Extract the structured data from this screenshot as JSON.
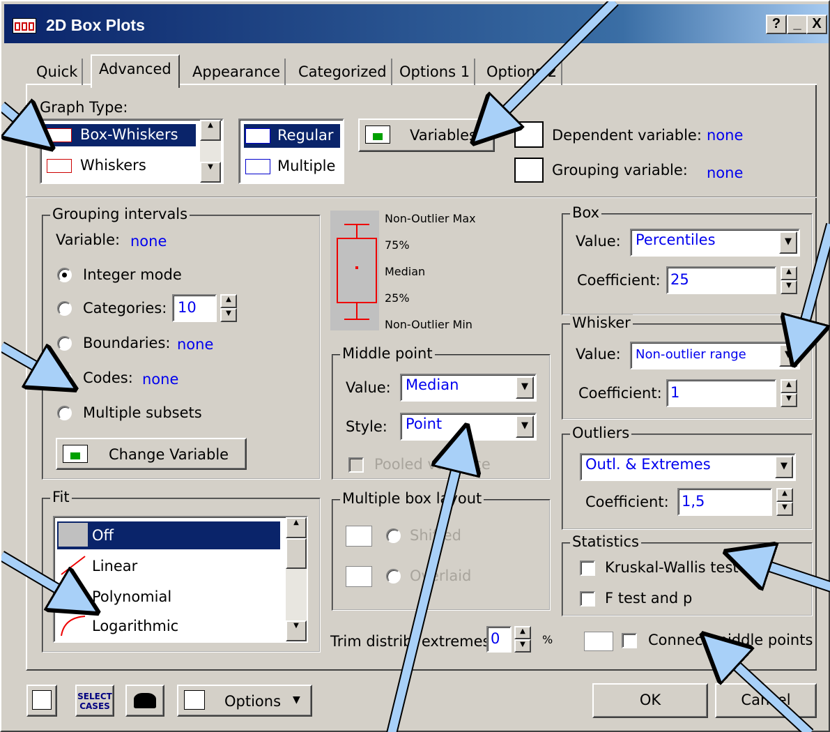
{
  "window": {
    "title": "2D Box Plots",
    "help": "?",
    "minimize": "_",
    "close": "X"
  },
  "tabs": [
    "Quick",
    "Advanced",
    "Appearance",
    "Categorized",
    "Options 1",
    "Options 2"
  ],
  "graph_type": {
    "label": "Graph Type:",
    "types": [
      "Box-Whiskers",
      "Whiskers"
    ],
    "layout": [
      "Regular",
      "Multiple"
    ],
    "variables_btn": "Variables...",
    "dependent_label": "Dependent variable:",
    "dependent_value": "none",
    "grouping_label": "Grouping variable:",
    "grouping_value": "none"
  },
  "grouping": {
    "legend": "Grouping intervals",
    "variable_label": "Variable:",
    "variable_value": "none",
    "integer_mode": "Integer mode",
    "categories": "Categories:",
    "categories_value": "10",
    "boundaries": "Boundaries:",
    "boundaries_value": "none",
    "codes": "Codes:",
    "codes_value": "none",
    "multiple_subsets": "Multiple subsets",
    "change_btn": "Change Variable"
  },
  "diagram": {
    "max": "Non-Outlier Max",
    "q75": "75%",
    "median": "Median",
    "q25": "25%",
    "min": "Non-Outlier Min"
  },
  "middle": {
    "legend": "Middle point",
    "value_label": "Value:",
    "value": "Median",
    "style_label": "Style:",
    "style": "Point",
    "pooled": "Pooled variance"
  },
  "layout": {
    "legend": "Multiple box layout",
    "shifted": "Shifted",
    "overlaid": "Overlaid"
  },
  "trim": {
    "label": "Trim distrib. extremes:",
    "value": "0",
    "unit": "%"
  },
  "box": {
    "legend": "Box",
    "value_label": "Value:",
    "value": "Percentiles",
    "coef_label": "Coefficient:",
    "coef": "25"
  },
  "whisker": {
    "legend": "Whisker",
    "value_label": "Value:",
    "value": "Non-outlier range",
    "coef_label": "Coefficient:",
    "coef": "1"
  },
  "outliers": {
    "legend": "Outliers",
    "value": "Outl. & Extremes",
    "coef_label": "Coefficient:",
    "coef": "1,5"
  },
  "statistics": {
    "legend": "Statistics",
    "kw": "Kruskal-Wallis test",
    "f": "F test and p"
  },
  "connect": "Connect middle points",
  "fit": {
    "legend": "Fit",
    "items": [
      "Off",
      "Linear",
      "Polynomial",
      "Logarithmic"
    ]
  },
  "footer": {
    "select_cases": "SELECT CASES",
    "options": "Options",
    "ok": "OK",
    "cancel": "Cancel"
  }
}
